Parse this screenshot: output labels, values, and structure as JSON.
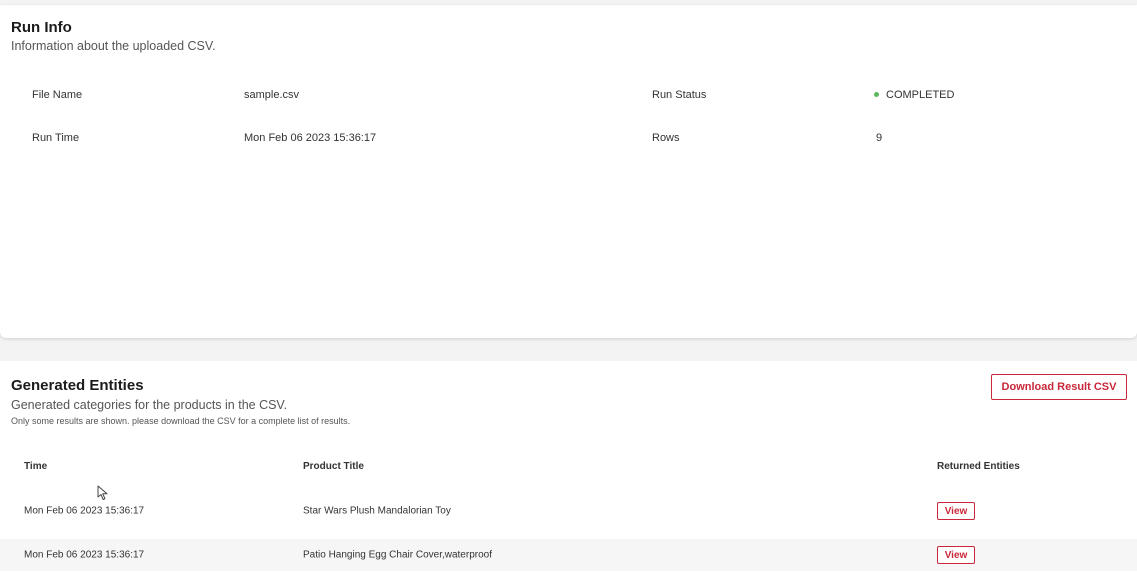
{
  "run_info": {
    "title": "Run Info",
    "subtitle": "Information about the uploaded CSV.",
    "file_name_label": "File Name",
    "file_name_value": "sample.csv",
    "run_status_label": "Run Status",
    "run_status_value": "COMPLETED",
    "run_time_label": "Run Time",
    "run_time_value": "Mon Feb 06 2023 15:36:17",
    "rows_label": "Rows",
    "rows_value": "9"
  },
  "entities": {
    "title": "Generated Entities",
    "subtitle": "Generated categories for the products in the CSV.",
    "note": "Only some results are shown. please download the CSV for a complete list of results.",
    "download_label": "Download Result CSV",
    "columns": {
      "time": "Time",
      "product_title": "Product Title",
      "returned_entities": "Returned Entities"
    },
    "rows": [
      {
        "time": "Mon Feb 06 2023 15:36:17",
        "product_title": "Star Wars Plush Mandalorian Toy",
        "action": "View"
      },
      {
        "time": "Mon Feb 06 2023 15:36:17",
        "product_title": "Patio Hanging Egg Chair Cover,waterproof",
        "action": "View"
      }
    ]
  },
  "colors": {
    "accent": "#c8283a",
    "status_completed": "#5cb85c"
  }
}
